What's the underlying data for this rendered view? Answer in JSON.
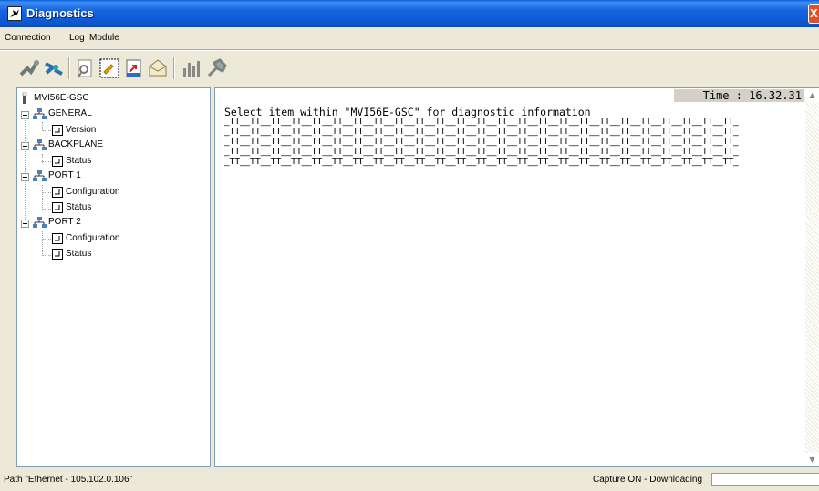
{
  "window": {
    "title": "Diagnostics",
    "close_symbol": "X"
  },
  "menu": [
    "Connection",
    "Log",
    "Module"
  ],
  "toolbar": {
    "icons": [
      "connect-icon",
      "disconnect-icon",
      "find-icon",
      "capture-icon",
      "export-icon",
      "mail-icon",
      "chart-icon",
      "settings-icon"
    ]
  },
  "tree": {
    "root": "MVI56E-GSC",
    "groups": [
      {
        "label": "GENERAL",
        "children": [
          "Version"
        ]
      },
      {
        "label": "BACKPLANE",
        "children": [
          "Status"
        ]
      },
      {
        "label": "PORT 1",
        "children": [
          "Configuration",
          "Status"
        ]
      },
      {
        "label": "PORT 2",
        "children": [
          "Configuration",
          "Status"
        ]
      }
    ]
  },
  "output": {
    "time_label": "Time : 16.32.31",
    "message": "Select item within \"MVI56E-GSC\" for diagnostic information",
    "pattern_lines": [
      "_TT__TT__TT__TT__TT__TT__TT__TT__TT__TT__TT__TT__TT__TT__TT__TT__TT__TT__TT__TT__TT__TT__TT__TT__TT_",
      "_TT__TT__TT__TT__TT__TT__TT__TT__TT__TT__TT__TT__TT__TT__TT__TT__TT__TT__TT__TT__TT__TT__TT__TT__TT_",
      "_TT__TT__TT__TT__TT__TT__TT__TT__TT__TT__TT__TT__TT__TT__TT__TT__TT__TT__TT__TT__TT__TT__TT__TT__TT_",
      "_TT__TT__TT__TT__TT__TT__TT__TT__TT__TT__TT__TT__TT__TT__TT__TT__TT__TT__TT__TT__TT__TT__TT__TT__TT_",
      "_TT__TT__TT__TT__TT__TT__TT__TT__TT__TT__TT__TT__TT__TT__TT__TT__TT__TT__TT__TT__TT__TT__TT__TT__TT_"
    ]
  },
  "status": {
    "path": "Path \"Ethernet - 105.102.0.106\"",
    "capture": "Capture ON - Downloading"
  }
}
